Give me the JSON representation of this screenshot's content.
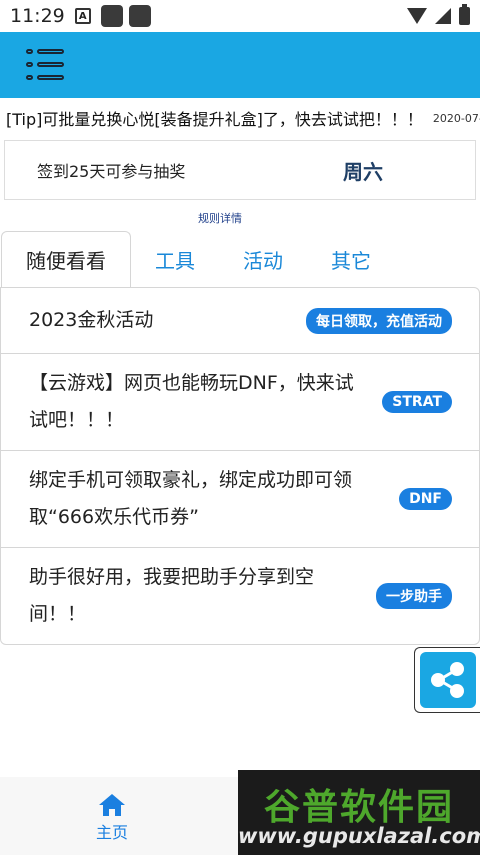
{
  "status_bar": {
    "time": "11:29",
    "notification_badge": "A"
  },
  "marquee": {
    "text": "[Tip]可批量兑换心悦[装备提升礼盒]了，快去试试把！！！",
    "date": "2020-07-"
  },
  "signin": {
    "text": "签到25天可参与抽奖",
    "day": "周六"
  },
  "rules_link": "规则详情",
  "tabs": [
    {
      "label": "随便看看",
      "active": true
    },
    {
      "label": "工具",
      "active": false
    },
    {
      "label": "活动",
      "active": false
    },
    {
      "label": "其它",
      "active": false
    }
  ],
  "items": [
    {
      "text": "2023金秋活动",
      "badge": "每日领取，充值活动"
    },
    {
      "text": "【云游戏】网页也能畅玩DNF，快来试试吧！！！",
      "badge": "STRAT"
    },
    {
      "text": "绑定手机可领取豪礼，绑定成功即可领取“666欢乐代币券”",
      "badge": "DNF"
    },
    {
      "text": "助手很好用，我要把助手分享到空间！！",
      "badge": "一步助手"
    }
  ],
  "bottom_nav": {
    "home_label": "主页"
  },
  "watermark": {
    "title": "谷普软件园",
    "url": "www.gupuxlazal.com"
  },
  "colors": {
    "appbar": "#1aa7e3",
    "accent": "#1a7fe0",
    "tab_text": "#1a88d8"
  },
  "icons": {
    "menu": "menu-list-icon",
    "share": "share-icon",
    "home": "home-icon"
  }
}
